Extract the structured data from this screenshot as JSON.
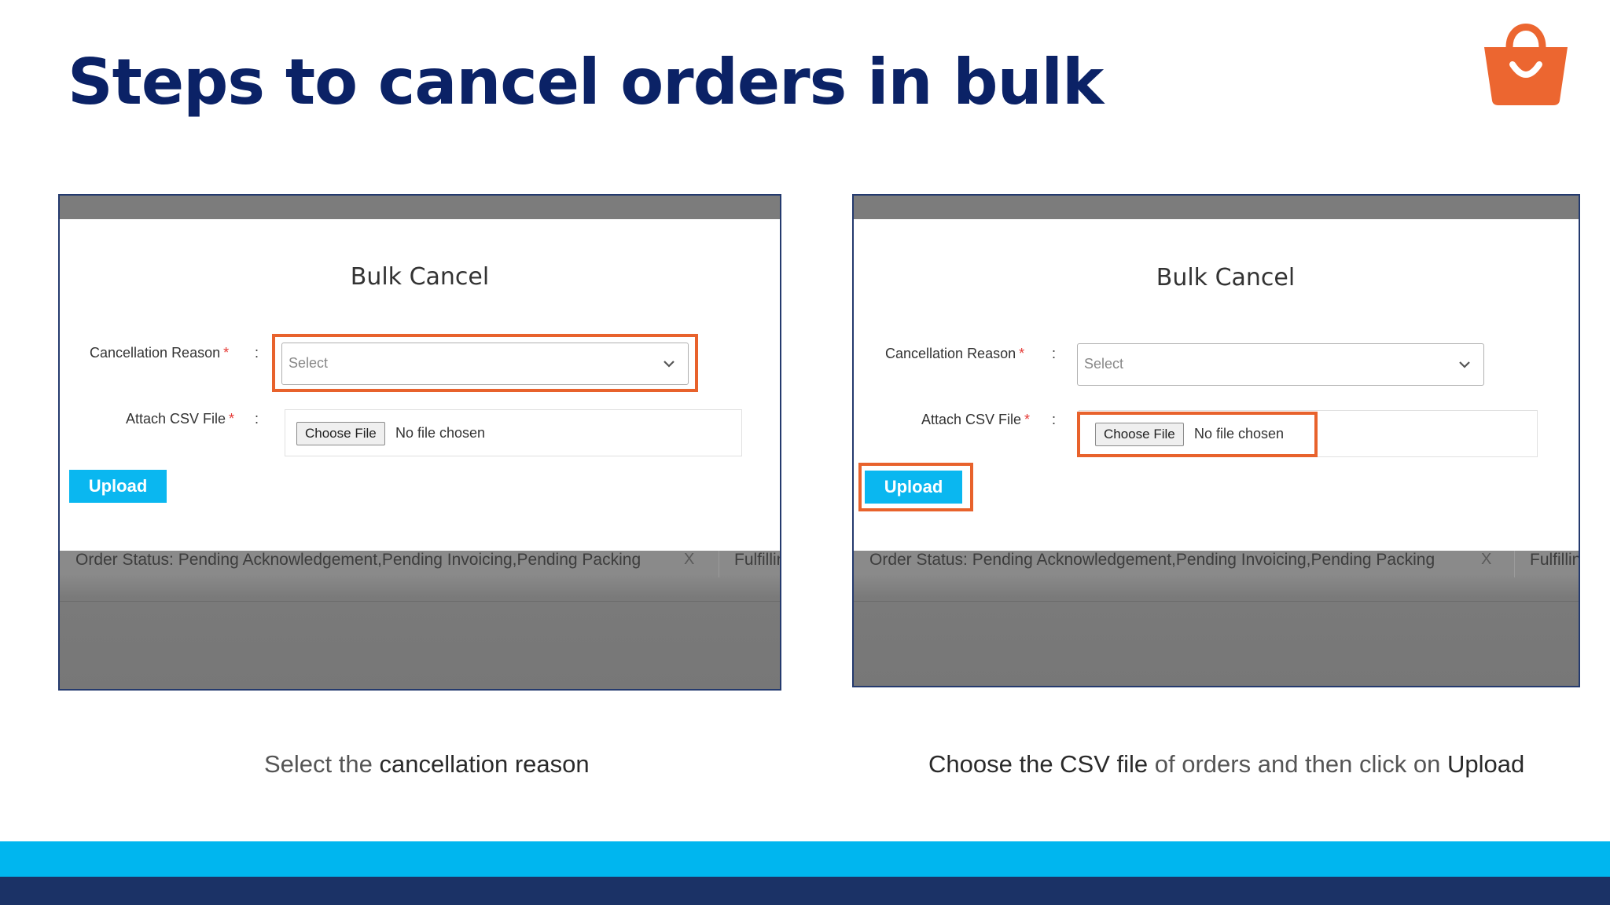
{
  "slide": {
    "title": "Steps to cancel orders in bulk",
    "logo": "shopping-bag-icon"
  },
  "panels": [
    {
      "modal_title": "Bulk Cancel",
      "cancellation_label": "Cancellation Reason",
      "required_mark": "*",
      "colon": ":",
      "select_placeholder": "Select",
      "csv_label": "Attach CSV File",
      "choose_file": "Choose File",
      "no_file": "No file chosen",
      "upload": "Upload",
      "status_text": "Order Status: Pending Acknowledgement,Pending Invoicing,Pending Packing",
      "status_close": "X",
      "status_next": "Fulfillin",
      "highlighted": [
        "cancellation-reason-select"
      ]
    },
    {
      "modal_title": "Bulk Cancel",
      "cancellation_label": "Cancellation Reason",
      "required_mark": "*",
      "colon": ":",
      "select_placeholder": "Select",
      "csv_label": "Attach CSV File",
      "choose_file": "Choose File",
      "no_file": "No file chosen",
      "upload": "Upload",
      "status_text": "Order Status: Pending Acknowledgement,Pending Invoicing,Pending Packing",
      "status_close": "X",
      "status_next": "Fulfillin",
      "highlighted": [
        "choose-file-button",
        "upload-button"
      ]
    }
  ],
  "captions": [
    {
      "part1": "Select the ",
      "part2": "cancellation reason"
    },
    {
      "part1": "Choose the CSV file",
      "part2": " of orders and then click on ",
      "part3": "Upload"
    }
  ],
  "colors": {
    "title": "#0b2266",
    "highlight": "#e8622c",
    "upload_button": "#0ab7f0",
    "band_light": "#00b6ef",
    "band_dark": "#1b3266",
    "logo": "#ec6630"
  }
}
